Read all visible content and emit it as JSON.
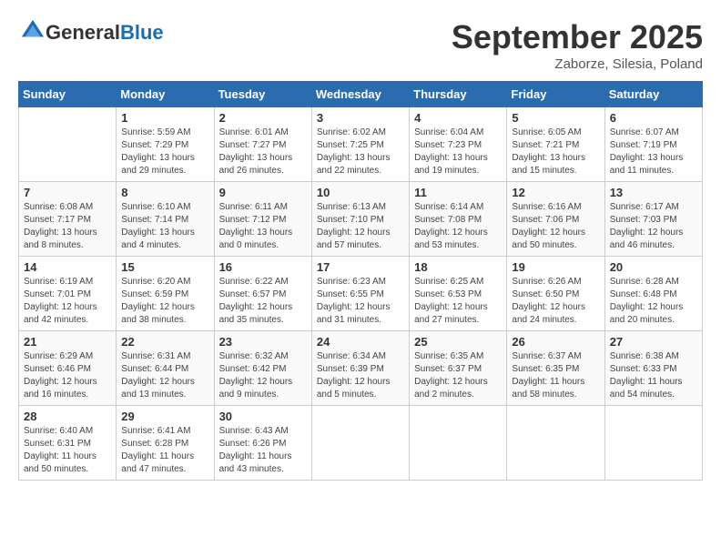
{
  "header": {
    "logo_line1": "General",
    "logo_line2": "Blue",
    "month": "September 2025",
    "location": "Zaborze, Silesia, Poland"
  },
  "days_of_week": [
    "Sunday",
    "Monday",
    "Tuesday",
    "Wednesday",
    "Thursday",
    "Friday",
    "Saturday"
  ],
  "weeks": [
    [
      {
        "day": "",
        "sunrise": "",
        "sunset": "",
        "daylight": ""
      },
      {
        "day": "1",
        "sunrise": "Sunrise: 5:59 AM",
        "sunset": "Sunset: 7:29 PM",
        "daylight": "Daylight: 13 hours and 29 minutes."
      },
      {
        "day": "2",
        "sunrise": "Sunrise: 6:01 AM",
        "sunset": "Sunset: 7:27 PM",
        "daylight": "Daylight: 13 hours and 26 minutes."
      },
      {
        "day": "3",
        "sunrise": "Sunrise: 6:02 AM",
        "sunset": "Sunset: 7:25 PM",
        "daylight": "Daylight: 13 hours and 22 minutes."
      },
      {
        "day": "4",
        "sunrise": "Sunrise: 6:04 AM",
        "sunset": "Sunset: 7:23 PM",
        "daylight": "Daylight: 13 hours and 19 minutes."
      },
      {
        "day": "5",
        "sunrise": "Sunrise: 6:05 AM",
        "sunset": "Sunset: 7:21 PM",
        "daylight": "Daylight: 13 hours and 15 minutes."
      },
      {
        "day": "6",
        "sunrise": "Sunrise: 6:07 AM",
        "sunset": "Sunset: 7:19 PM",
        "daylight": "Daylight: 13 hours and 11 minutes."
      }
    ],
    [
      {
        "day": "7",
        "sunrise": "Sunrise: 6:08 AM",
        "sunset": "Sunset: 7:17 PM",
        "daylight": "Daylight: 13 hours and 8 minutes."
      },
      {
        "day": "8",
        "sunrise": "Sunrise: 6:10 AM",
        "sunset": "Sunset: 7:14 PM",
        "daylight": "Daylight: 13 hours and 4 minutes."
      },
      {
        "day": "9",
        "sunrise": "Sunrise: 6:11 AM",
        "sunset": "Sunset: 7:12 PM",
        "daylight": "Daylight: 13 hours and 0 minutes."
      },
      {
        "day": "10",
        "sunrise": "Sunrise: 6:13 AM",
        "sunset": "Sunset: 7:10 PM",
        "daylight": "Daylight: 12 hours and 57 minutes."
      },
      {
        "day": "11",
        "sunrise": "Sunrise: 6:14 AM",
        "sunset": "Sunset: 7:08 PM",
        "daylight": "Daylight: 12 hours and 53 minutes."
      },
      {
        "day": "12",
        "sunrise": "Sunrise: 6:16 AM",
        "sunset": "Sunset: 7:06 PM",
        "daylight": "Daylight: 12 hours and 50 minutes."
      },
      {
        "day": "13",
        "sunrise": "Sunrise: 6:17 AM",
        "sunset": "Sunset: 7:03 PM",
        "daylight": "Daylight: 12 hours and 46 minutes."
      }
    ],
    [
      {
        "day": "14",
        "sunrise": "Sunrise: 6:19 AM",
        "sunset": "Sunset: 7:01 PM",
        "daylight": "Daylight: 12 hours and 42 minutes."
      },
      {
        "day": "15",
        "sunrise": "Sunrise: 6:20 AM",
        "sunset": "Sunset: 6:59 PM",
        "daylight": "Daylight: 12 hours and 38 minutes."
      },
      {
        "day": "16",
        "sunrise": "Sunrise: 6:22 AM",
        "sunset": "Sunset: 6:57 PM",
        "daylight": "Daylight: 12 hours and 35 minutes."
      },
      {
        "day": "17",
        "sunrise": "Sunrise: 6:23 AM",
        "sunset": "Sunset: 6:55 PM",
        "daylight": "Daylight: 12 hours and 31 minutes."
      },
      {
        "day": "18",
        "sunrise": "Sunrise: 6:25 AM",
        "sunset": "Sunset: 6:53 PM",
        "daylight": "Daylight: 12 hours and 27 minutes."
      },
      {
        "day": "19",
        "sunrise": "Sunrise: 6:26 AM",
        "sunset": "Sunset: 6:50 PM",
        "daylight": "Daylight: 12 hours and 24 minutes."
      },
      {
        "day": "20",
        "sunrise": "Sunrise: 6:28 AM",
        "sunset": "Sunset: 6:48 PM",
        "daylight": "Daylight: 12 hours and 20 minutes."
      }
    ],
    [
      {
        "day": "21",
        "sunrise": "Sunrise: 6:29 AM",
        "sunset": "Sunset: 6:46 PM",
        "daylight": "Daylight: 12 hours and 16 minutes."
      },
      {
        "day": "22",
        "sunrise": "Sunrise: 6:31 AM",
        "sunset": "Sunset: 6:44 PM",
        "daylight": "Daylight: 12 hours and 13 minutes."
      },
      {
        "day": "23",
        "sunrise": "Sunrise: 6:32 AM",
        "sunset": "Sunset: 6:42 PM",
        "daylight": "Daylight: 12 hours and 9 minutes."
      },
      {
        "day": "24",
        "sunrise": "Sunrise: 6:34 AM",
        "sunset": "Sunset: 6:39 PM",
        "daylight": "Daylight: 12 hours and 5 minutes."
      },
      {
        "day": "25",
        "sunrise": "Sunrise: 6:35 AM",
        "sunset": "Sunset: 6:37 PM",
        "daylight": "Daylight: 12 hours and 2 minutes."
      },
      {
        "day": "26",
        "sunrise": "Sunrise: 6:37 AM",
        "sunset": "Sunset: 6:35 PM",
        "daylight": "Daylight: 11 hours and 58 minutes."
      },
      {
        "day": "27",
        "sunrise": "Sunrise: 6:38 AM",
        "sunset": "Sunset: 6:33 PM",
        "daylight": "Daylight: 11 hours and 54 minutes."
      }
    ],
    [
      {
        "day": "28",
        "sunrise": "Sunrise: 6:40 AM",
        "sunset": "Sunset: 6:31 PM",
        "daylight": "Daylight: 11 hours and 50 minutes."
      },
      {
        "day": "29",
        "sunrise": "Sunrise: 6:41 AM",
        "sunset": "Sunset: 6:28 PM",
        "daylight": "Daylight: 11 hours and 47 minutes."
      },
      {
        "day": "30",
        "sunrise": "Sunrise: 6:43 AM",
        "sunset": "Sunset: 6:26 PM",
        "daylight": "Daylight: 11 hours and 43 minutes."
      },
      {
        "day": "",
        "sunrise": "",
        "sunset": "",
        "daylight": ""
      },
      {
        "day": "",
        "sunrise": "",
        "sunset": "",
        "daylight": ""
      },
      {
        "day": "",
        "sunrise": "",
        "sunset": "",
        "daylight": ""
      },
      {
        "day": "",
        "sunrise": "",
        "sunset": "",
        "daylight": ""
      }
    ]
  ]
}
